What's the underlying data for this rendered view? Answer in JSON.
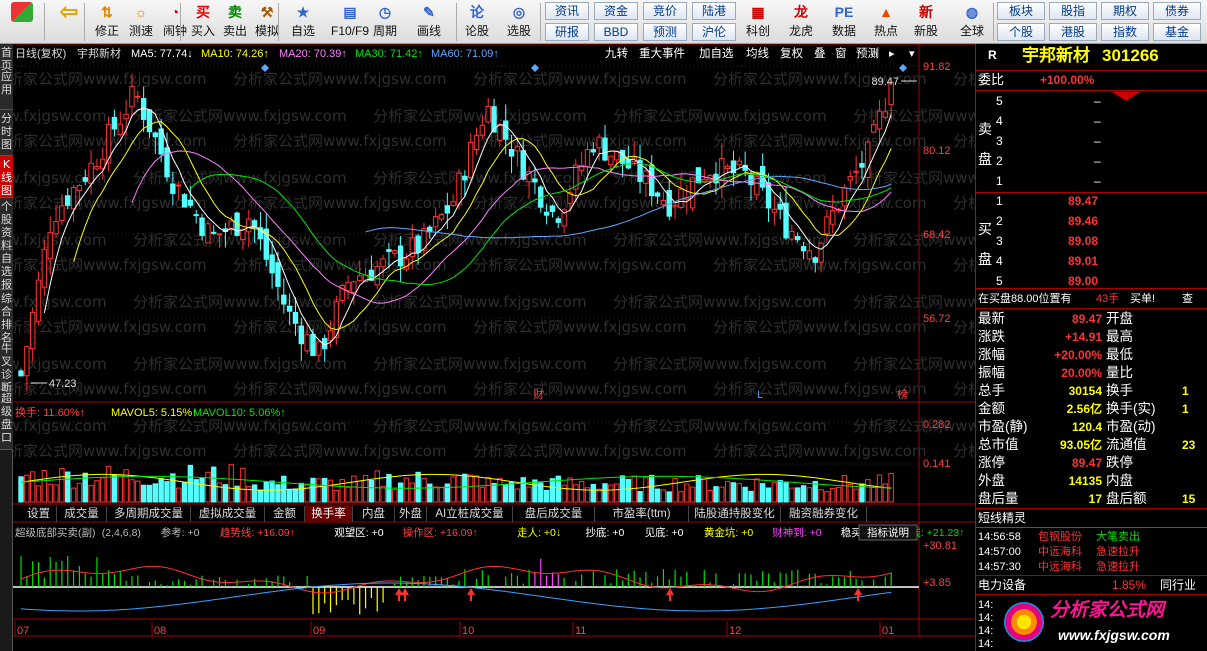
{
  "toolbar": {
    "items": [
      {
        "label": "",
        "icon": "home"
      },
      {
        "label": "",
        "icon": "back-arrow"
      },
      {
        "label": "修正",
        "icon": "arrow-up-down"
      },
      {
        "label": "测速",
        "icon": "signal"
      },
      {
        "label": "闹钟",
        "icon": "alarm"
      },
      {
        "label": "买入",
        "icon": "buy"
      },
      {
        "label": "卖出",
        "icon": "sell"
      },
      {
        "label": "模拟",
        "icon": "gavel"
      },
      {
        "label": "自选",
        "icon": "folder-star"
      },
      {
        "label": "F10/F9",
        "icon": "f10"
      },
      {
        "label": "周期",
        "icon": "clock"
      },
      {
        "label": "画线",
        "icon": "pen"
      },
      {
        "label": "论股",
        "icon": "talk"
      },
      {
        "label": "选股",
        "icon": "pick"
      }
    ],
    "buttons_a": [
      {
        "top": "资讯",
        "bottom": "研报"
      },
      {
        "top": "资金",
        "bottom": "BBD"
      },
      {
        "top": "竞价",
        "bottom": "预测"
      },
      {
        "top": "陆港",
        "bottom": "沪伦"
      }
    ],
    "items_b": [
      {
        "label": "科创",
        "icon": "chart"
      },
      {
        "label": "龙虎",
        "icon": "dragon"
      },
      {
        "label": "数据",
        "icon": "pe"
      },
      {
        "label": "热点",
        "icon": "hot"
      },
      {
        "label": "新股",
        "icon": "new-stock"
      },
      {
        "label": "全球",
        "icon": "globe"
      }
    ],
    "buttons_b": [
      {
        "top": "板块",
        "bottom": "个股"
      },
      {
        "top": "股指",
        "bottom": "港股"
      },
      {
        "top": "期权",
        "bottom": "指数"
      },
      {
        "top": "债券",
        "bottom": "基金"
      }
    ]
  },
  "leftnav": [
    "首页",
    "应用",
    "分时图",
    "K线图",
    "个股资料",
    "自选报",
    "综合排名",
    "牛叉诊断",
    "超级盘口"
  ],
  "kline_header": {
    "name": "日线(复权)",
    "stock": "宇邦新材",
    "ma5": "MA5: 77.74↓",
    "ma10": "MA10: 74.26↑",
    "ma20": "MA20: 70.39↑",
    "ma30": "MA30: 71.42↑",
    "ma60": "MA60: 71.09↑"
  },
  "kline_tools": [
    "九转",
    "重大事件",
    "加自选",
    "均线",
    "复权",
    "叠",
    "窗",
    "预测"
  ],
  "price_axis": [
    "91.82",
    "80.12",
    "68.42",
    "56.72"
  ],
  "kline_marks": {
    "high": "89.47",
    "low": "47.23",
    "cai": "财",
    "L": "L",
    "bang": "榜"
  },
  "vol_header": {
    "turnover": "换手: 11.60%↑",
    "mavol5": "MAVOL5: 5.15%↑",
    "mavol10": "MAVOL10: 5.06%↑"
  },
  "vol_axis": [
    "0.282",
    "0.141"
  ],
  "tabs": [
    "设置",
    "成交量",
    "多周期成交量",
    "虚拟成交量",
    "金额",
    "换手率",
    "内盘",
    "外盘",
    "AI立桩成交量",
    "盘后成交量",
    "市盈率(ttm)",
    "陆股通持股变化",
    "融资融券变化"
  ],
  "ind_header": {
    "name": "超级底部买卖(副)",
    "params": "(2,4,6,8)",
    "ref": "参考: +0",
    "trend": "趋势线: +16.09↑",
    "watch": "观望区: +0",
    "op": "操作区: +16.09↑",
    "walk": "走人: +0↓",
    "bottom": "抄底: +0",
    "see": "见底: +0",
    "gold": "黄金坑: +0",
    "god": "财神到: +0",
    "stable": "稳买: +0",
    "wonder": "奇线: +21.23↑",
    "explain": "指标说明"
  },
  "ind_axis": [
    "+30.81",
    "+3.85"
  ],
  "date_axis": [
    "07",
    "08",
    "09",
    "10",
    "11",
    "12",
    "01"
  ],
  "watermark": "分析家公式网www.fxjgsw.com",
  "quote": {
    "code_r": "R",
    "name": "宇邦新材",
    "code": "301266",
    "weibi_label": "委比",
    "weibi": "+100.00%",
    "sell_label": "卖盘",
    "buy_label": "买盘",
    "sell": [
      {
        "n": "5",
        "p": "–"
      },
      {
        "n": "4",
        "p": "–"
      },
      {
        "n": "3",
        "p": "–"
      },
      {
        "n": "2",
        "p": "–"
      },
      {
        "n": "1",
        "p": "–"
      }
    ],
    "buy": [
      {
        "n": "1",
        "p": "89.47"
      },
      {
        "n": "2",
        "p": "89.46"
      },
      {
        "n": "3",
        "p": "89.08"
      },
      {
        "n": "4",
        "p": "89.01"
      },
      {
        "n": "5",
        "p": "89.00"
      }
    ],
    "queue": "在买盘88.00位置有",
    "queue_vol": "43手",
    "queue_action": "买单!",
    "queue_btn": "查",
    "stats": [
      {
        "l": "最新",
        "v": "89.47",
        "l2": "开盘",
        "v2": ""
      },
      {
        "l": "涨跌",
        "v": "+14.91",
        "l2": "最高",
        "v2": ""
      },
      {
        "l": "涨幅",
        "v": "+20.00%",
        "l2": "最低",
        "v2": ""
      },
      {
        "l": "振幅",
        "v": "20.00%",
        "l2": "量比",
        "v2": ""
      },
      {
        "l": "总手",
        "v": "30154",
        "l2": "换手",
        "v2": "1"
      },
      {
        "l": "金额",
        "v": "2.56亿",
        "l2": "换手(实)",
        "v2": "1"
      },
      {
        "l": "市盈(静)",
        "v": "120.4",
        "l2": "市盈(动)",
        "v2": ""
      },
      {
        "l": "总市值",
        "v": "93.05亿",
        "l2": "流通值",
        "v2": "23"
      },
      {
        "l": "涨停",
        "v": "89.47",
        "l2": "跌停",
        "v2": ""
      },
      {
        "l": "外盘",
        "v": "14135",
        "l2": "内盘",
        "v2": ""
      },
      {
        "l": "盘后量",
        "v": "17",
        "l2": "盘后额",
        "v2": "15"
      }
    ],
    "short_title": "短线精灵",
    "short": [
      {
        "t": "14:56:58",
        "s": "包钢股份",
        "a": "大笔卖出"
      },
      {
        "t": "14:57:00",
        "s": "中远海科",
        "a": "急速拉升"
      },
      {
        "t": "14:57:30",
        "s": "中远海科",
        "a": "急速拉升"
      }
    ],
    "sector": "电力设备",
    "sector_pct": "1.85%",
    "sector_tab": "同行业",
    "times": [
      "14:",
      "14:",
      "14:",
      "14:"
    ],
    "logo_text": "分析家公式网",
    "logo_url": "www.fxjgsw.com"
  },
  "colors": {
    "up": "#ff3232",
    "down": "#54ffff",
    "ma5": "#ffffff",
    "ma10": "#ffff00",
    "ma20": "#ff80ff",
    "ma30": "#00e600",
    "ma60": "#5fa8ff"
  }
}
